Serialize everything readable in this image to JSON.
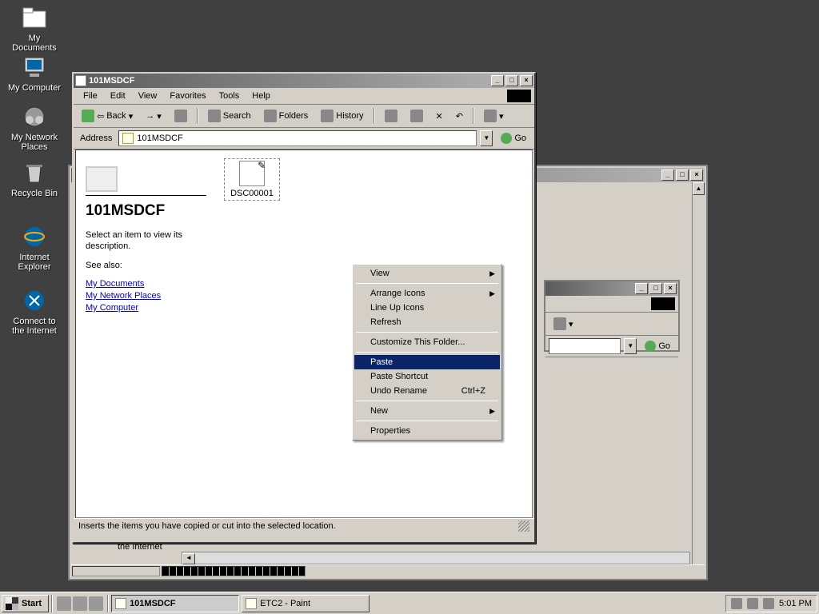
{
  "desktop_icons": [
    {
      "name": "my-documents",
      "label": "My Documents"
    },
    {
      "name": "my-computer",
      "label": "My Computer"
    },
    {
      "name": "my-network-places",
      "label": "My Network Places"
    },
    {
      "name": "recycle-bin",
      "label": "Recycle Bin"
    },
    {
      "name": "internet-explorer",
      "label": "Internet Explorer"
    },
    {
      "name": "connect-internet",
      "label": "Connect to the Internet"
    }
  ],
  "main_window": {
    "title": "101MSDCF",
    "menu": [
      "File",
      "Edit",
      "View",
      "Favorites",
      "Tools",
      "Help"
    ],
    "toolbar": {
      "back": "Back",
      "search": "Search",
      "folders": "Folders",
      "history": "History"
    },
    "address_label": "Address",
    "address_value": "101MSDCF",
    "go_label": "Go",
    "web_panel": {
      "title": "101MSDCF",
      "hint": "Select an item to view its description.",
      "see_also": "See also:",
      "links": [
        "My Documents",
        "My Network Places",
        "My Computer"
      ]
    },
    "files": [
      {
        "name": "DSC00001"
      }
    ],
    "status": "Inserts the items you have copied or cut into the selected location."
  },
  "context_menu": {
    "items": [
      {
        "label": "View",
        "submenu": true
      },
      {
        "sep": true
      },
      {
        "label": "Arrange Icons",
        "submenu": true
      },
      {
        "label": "Line Up Icons"
      },
      {
        "label": "Refresh"
      },
      {
        "sep": true
      },
      {
        "label": "Customize This Folder..."
      },
      {
        "sep": true
      },
      {
        "label": "Paste",
        "highlight": true
      },
      {
        "label": "Paste Shortcut"
      },
      {
        "label": "Undo Rename",
        "shortcut": "Ctrl+Z"
      },
      {
        "sep": true
      },
      {
        "label": "New",
        "submenu": true
      },
      {
        "sep": true
      },
      {
        "label": "Properties"
      }
    ]
  },
  "bg_window2": {
    "go_label": "Go",
    "the_internet": "the Internet"
  },
  "taskbar": {
    "start": "Start",
    "buttons": [
      {
        "label": "101MSDCF",
        "active": true
      },
      {
        "label": "ETC2 - Paint",
        "active": false
      }
    ],
    "clock": "5:01 PM"
  }
}
